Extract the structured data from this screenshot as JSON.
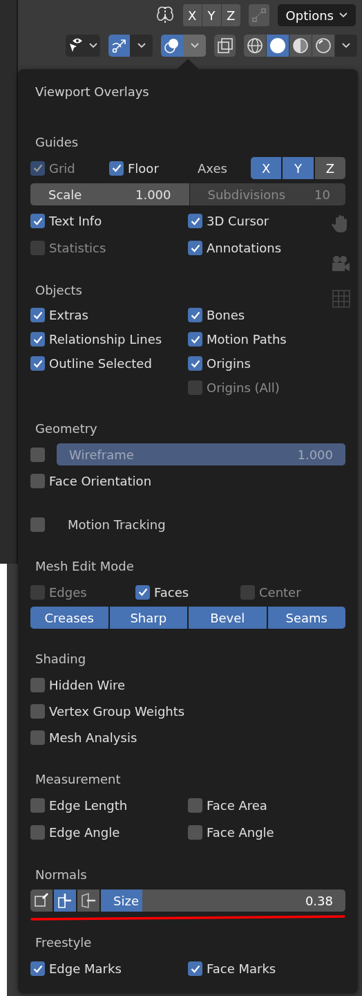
{
  "toolbar": {
    "mirror_axes": [
      {
        "label": "X",
        "selected": false
      },
      {
        "label": "Y",
        "selected": false
      },
      {
        "label": "Z",
        "selected": false
      }
    ],
    "options": {
      "label": "Options"
    },
    "gizmo": {
      "selected": true
    },
    "overlays": {
      "selected": true
    },
    "shading": [
      {
        "selected": false
      },
      {
        "selected": true
      },
      {
        "selected": false
      },
      {
        "selected": false
      }
    ]
  },
  "panel": {
    "title": "Viewport Overlays",
    "sections": [
      {
        "heading": "Guides",
        "rows": [
          {
            "kind": "guides",
            "items": [
              {
                "label": "Grid",
                "checked": true,
                "disabled": true
              },
              {
                "label": "Floor",
                "checked": true,
                "disabled": false
              }
            ],
            "axes": {
              "label": "Axes",
              "options": [
                {
                  "label": "X",
                  "selected": true
                },
                {
                  "label": "Y",
                  "selected": true
                },
                {
                  "label": "Z",
                  "selected": false
                }
              ]
            }
          },
          {
            "kind": "fields",
            "items": [
              {
                "label": "Scale",
                "value": "1.000",
                "disabled": false
              },
              {
                "label": "Subdivisions",
                "value": "10",
                "disabled": true
              }
            ]
          },
          {
            "kind": "columns",
            "left": [
              {
                "label": "Text Info",
                "checked": true,
                "disabled": false
              },
              {
                "label": "Statistics",
                "checked": false,
                "disabled": true
              }
            ],
            "right": [
              {
                "label": "3D Cursor",
                "checked": true,
                "disabled": false
              },
              {
                "label": "Annotations",
                "checked": true,
                "disabled": false
              }
            ]
          }
        ]
      },
      {
        "heading": "Objects",
        "rows": [
          {
            "kind": "columns",
            "tight": true,
            "left": [
              {
                "label": "Extras",
                "checked": true,
                "disabled": false
              },
              {
                "label": "Relationship Lines",
                "checked": true,
                "disabled": false
              },
              {
                "label": "Outline Selected",
                "checked": true,
                "disabled": false
              }
            ],
            "right": [
              {
                "label": "Bones",
                "checked": true,
                "disabled": false
              },
              {
                "label": "Motion Paths",
                "checked": true,
                "disabled": false
              },
              {
                "label": "Origins",
                "checked": true,
                "disabled": false
              },
              {
                "label": "Origins (All)",
                "checked": false,
                "disabled": true
              }
            ]
          }
        ]
      },
      {
        "heading": "Geometry",
        "rows": [
          {
            "kind": "check_slider",
            "checked": false,
            "label": "Wireframe",
            "value": "1.000",
            "disabled": true
          },
          {
            "kind": "checks",
            "items": [
              {
                "label": "Face Orientation",
                "checked": false,
                "disabled": false
              }
            ]
          }
        ]
      },
      {
        "rows": [
          {
            "kind": "subpanel",
            "label": "Motion Tracking",
            "checked": false
          }
        ]
      },
      {
        "heading": "Mesh Edit Mode",
        "rows": [
          {
            "kind": "checks",
            "items": [
              {
                "label": "Edges",
                "checked": false,
                "disabled": true
              },
              {
                "label": "Faces",
                "checked": true,
                "disabled": false
              },
              {
                "label": "Center",
                "checked": false,
                "disabled": true
              }
            ]
          },
          {
            "kind": "buttons",
            "options": [
              {
                "label": "Creases",
                "selected": true
              },
              {
                "label": "Sharp",
                "selected": true
              },
              {
                "label": "Bevel",
                "selected": true
              },
              {
                "label": "Seams",
                "selected": true
              }
            ]
          }
        ]
      },
      {
        "heading": "Shading",
        "rows": [
          {
            "kind": "checks",
            "items": [
              {
                "label": "Hidden Wire",
                "checked": false,
                "disabled": false
              }
            ]
          },
          {
            "kind": "checks",
            "items": [
              {
                "label": "Vertex Group Weights",
                "checked": false,
                "disabled": false
              }
            ]
          },
          {
            "kind": "checks",
            "items": [
              {
                "label": "Mesh Analysis",
                "checked": false,
                "disabled": false
              }
            ]
          }
        ]
      },
      {
        "heading": "Measurement",
        "rows": [
          {
            "kind": "columns",
            "left": [
              {
                "label": "Edge Length",
                "checked": false,
                "disabled": false
              },
              {
                "label": "Edge Angle",
                "checked": false,
                "disabled": false
              }
            ],
            "right": [
              {
                "label": "Face Area",
                "checked": false,
                "disabled": false
              },
              {
                "label": "Face Angle",
                "checked": false,
                "disabled": false
              }
            ]
          }
        ]
      },
      {
        "heading": "Normals",
        "rows": [
          {
            "kind": "normals",
            "modes": [
              {
                "selected": false
              },
              {
                "selected": true
              },
              {
                "selected": false
              }
            ],
            "field": {
              "label": "Size",
              "value": "0.38",
              "level": 0.17
            }
          }
        ]
      },
      {
        "heading": "Freestyle",
        "rows": [
          {
            "kind": "columns",
            "left": [
              {
                "label": "Edge Marks",
                "checked": true,
                "disabled": false
              }
            ],
            "right": [
              {
                "label": "Face Marks",
                "checked": true,
                "disabled": false
              }
            ]
          }
        ]
      }
    ]
  }
}
